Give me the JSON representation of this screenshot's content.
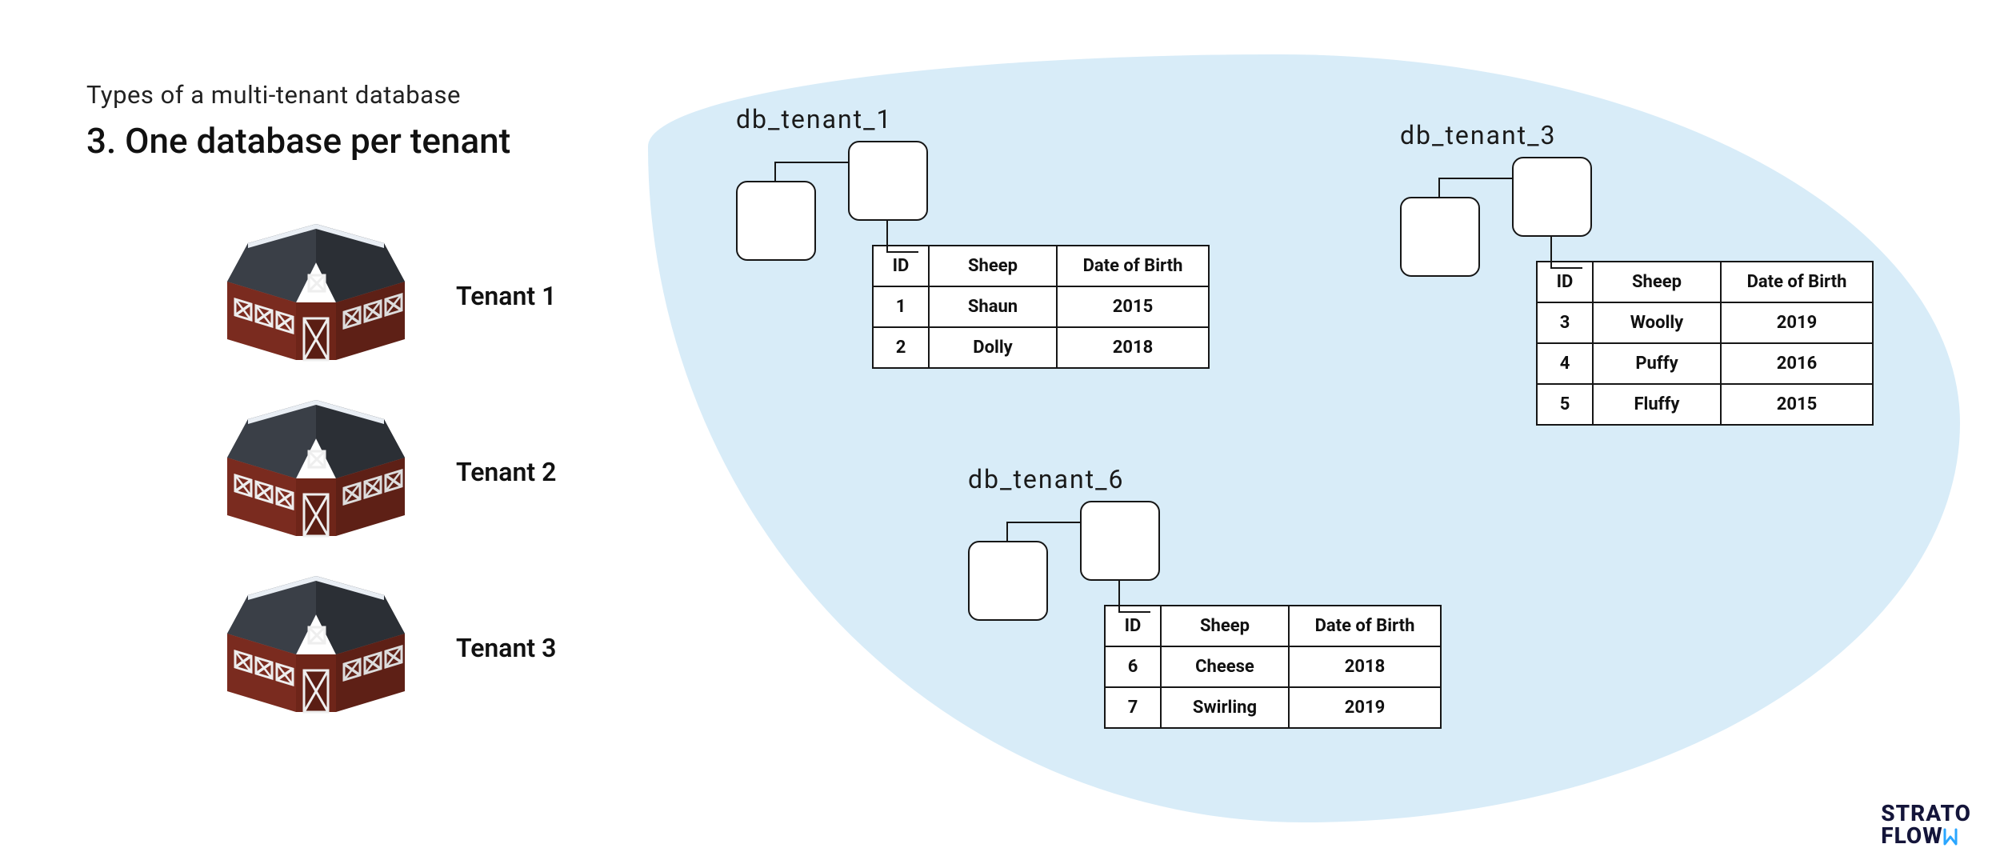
{
  "overtitle": "Types of a multi-tenant database",
  "title": "3. One database per tenant",
  "tenants": [
    {
      "label": "Tenant 1"
    },
    {
      "label": "Tenant 2"
    },
    {
      "label": "Tenant 3"
    }
  ],
  "table_headers": {
    "id": "ID",
    "sheep": "Sheep",
    "dob": "Date of Birth"
  },
  "databases": [
    {
      "name": "db_tenant_1",
      "rows": [
        {
          "id": "1",
          "sheep": "Shaun",
          "dob": "2015"
        },
        {
          "id": "2",
          "sheep": "Dolly",
          "dob": "2018"
        }
      ]
    },
    {
      "name": "db_tenant_3",
      "rows": [
        {
          "id": "3",
          "sheep": "Woolly",
          "dob": "2019"
        },
        {
          "id": "4",
          "sheep": "Puffy",
          "dob": "2016"
        },
        {
          "id": "5",
          "sheep": "Fluffy",
          "dob": "2015"
        }
      ]
    },
    {
      "name": "db_tenant_6",
      "rows": [
        {
          "id": "6",
          "sheep": "Cheese",
          "dob": "2018"
        },
        {
          "id": "7",
          "sheep": "Swirling",
          "dob": "2019"
        }
      ]
    }
  ],
  "brand": {
    "line1": "STRATO",
    "line2": "FLOW"
  }
}
